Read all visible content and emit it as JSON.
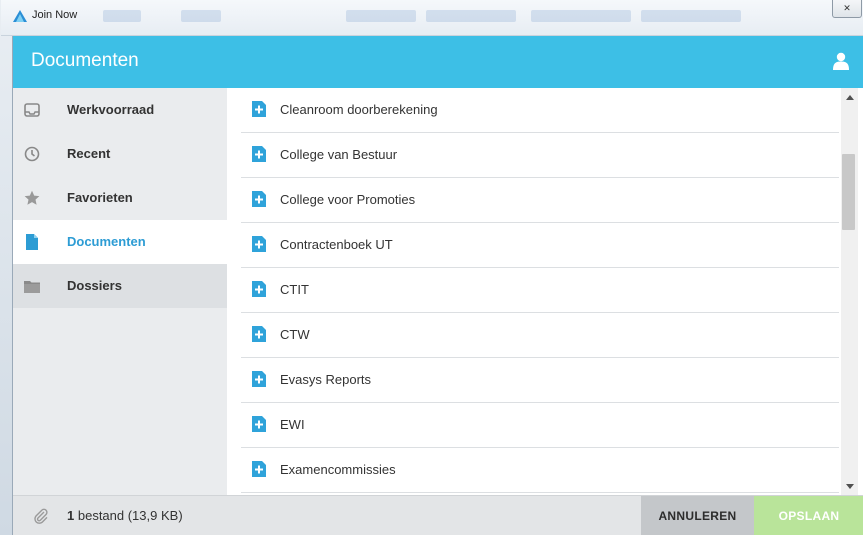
{
  "window": {
    "app_title": "Join Now",
    "close_glyph": "✕"
  },
  "header": {
    "title": "Documenten"
  },
  "sidebar": {
    "items": [
      {
        "label": "Werkvoorraad",
        "icon": "inbox-icon"
      },
      {
        "label": "Recent",
        "icon": "clock-icon"
      },
      {
        "label": "Favorieten",
        "icon": "star-icon"
      },
      {
        "label": "Documenten",
        "icon": "document-icon"
      },
      {
        "label": "Dossiers",
        "icon": "folder-icon"
      }
    ],
    "active_index": 3
  },
  "list": {
    "items": [
      "Cleanroom doorberekening",
      "College van Bestuur",
      "College voor Promoties",
      "Contractenboek UT",
      "CTIT",
      "CTW",
      "Evasys Reports",
      "EWI",
      "Examencommissies"
    ]
  },
  "footer": {
    "file_count": "1",
    "file_text": "bestand (13,9 KB)",
    "cancel_label": "ANNULEREN",
    "save_label": "OPSLAAN"
  },
  "colors": {
    "header": "#3dbfe6",
    "accent": "#2d9cd4",
    "save": "#b9e49a",
    "cancel": "#c4c7ca"
  }
}
